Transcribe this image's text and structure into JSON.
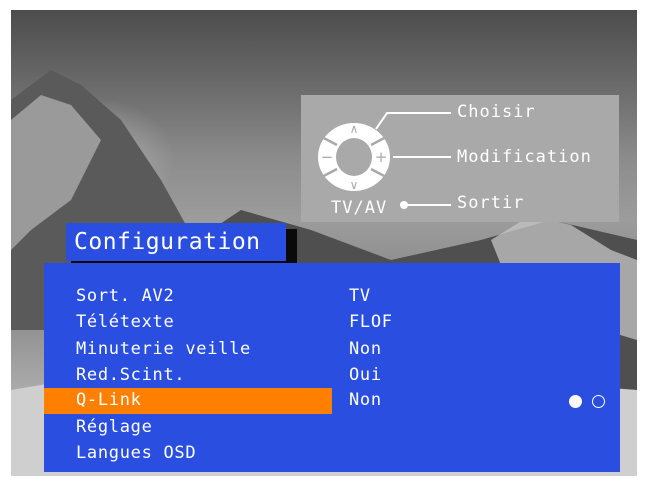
{
  "controls": {
    "choose_label": "Choisir",
    "modify_label": "Modification",
    "exit_label": "Sortir",
    "source_label": "TV/AV"
  },
  "menu": {
    "title": "Configuration",
    "items": [
      {
        "label": "Sort. AV2",
        "value": "TV"
      },
      {
        "label": "Télétexte",
        "value": "FLOF"
      },
      {
        "label": "Minuterie veille",
        "value": "Non"
      },
      {
        "label": "Red.Scint.",
        "value": "Oui"
      },
      {
        "label": "Q-Link",
        "value": "Non",
        "selected": true
      },
      {
        "label": "Réglage",
        "value": ""
      },
      {
        "label": "Langues OSD",
        "value": ""
      }
    ],
    "page_indicator": {
      "pages": 2,
      "current": 1
    }
  },
  "colors": {
    "menu_bg": "#2a4fe0",
    "highlight": "#ff8000",
    "panel_bg": "#a9a9a9",
    "text": "#ffffff"
  }
}
